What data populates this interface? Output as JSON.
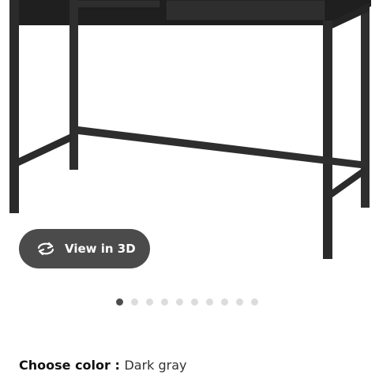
{
  "product": {
    "image_alt": "Dark gray metal desk frame"
  },
  "view3d": {
    "label": "View in 3D",
    "icon": "rotate-3d-icon"
  },
  "carousel": {
    "total_images": 10,
    "active_index": 0
  },
  "color": {
    "label": "Choose color :",
    "value": "Dark gray"
  },
  "colors": {
    "frame": "#2f2f2f",
    "button_bg": "#4b4b4b",
    "dot_active": "#4d4d4d",
    "dot_inactive": "#dcdcdc"
  }
}
